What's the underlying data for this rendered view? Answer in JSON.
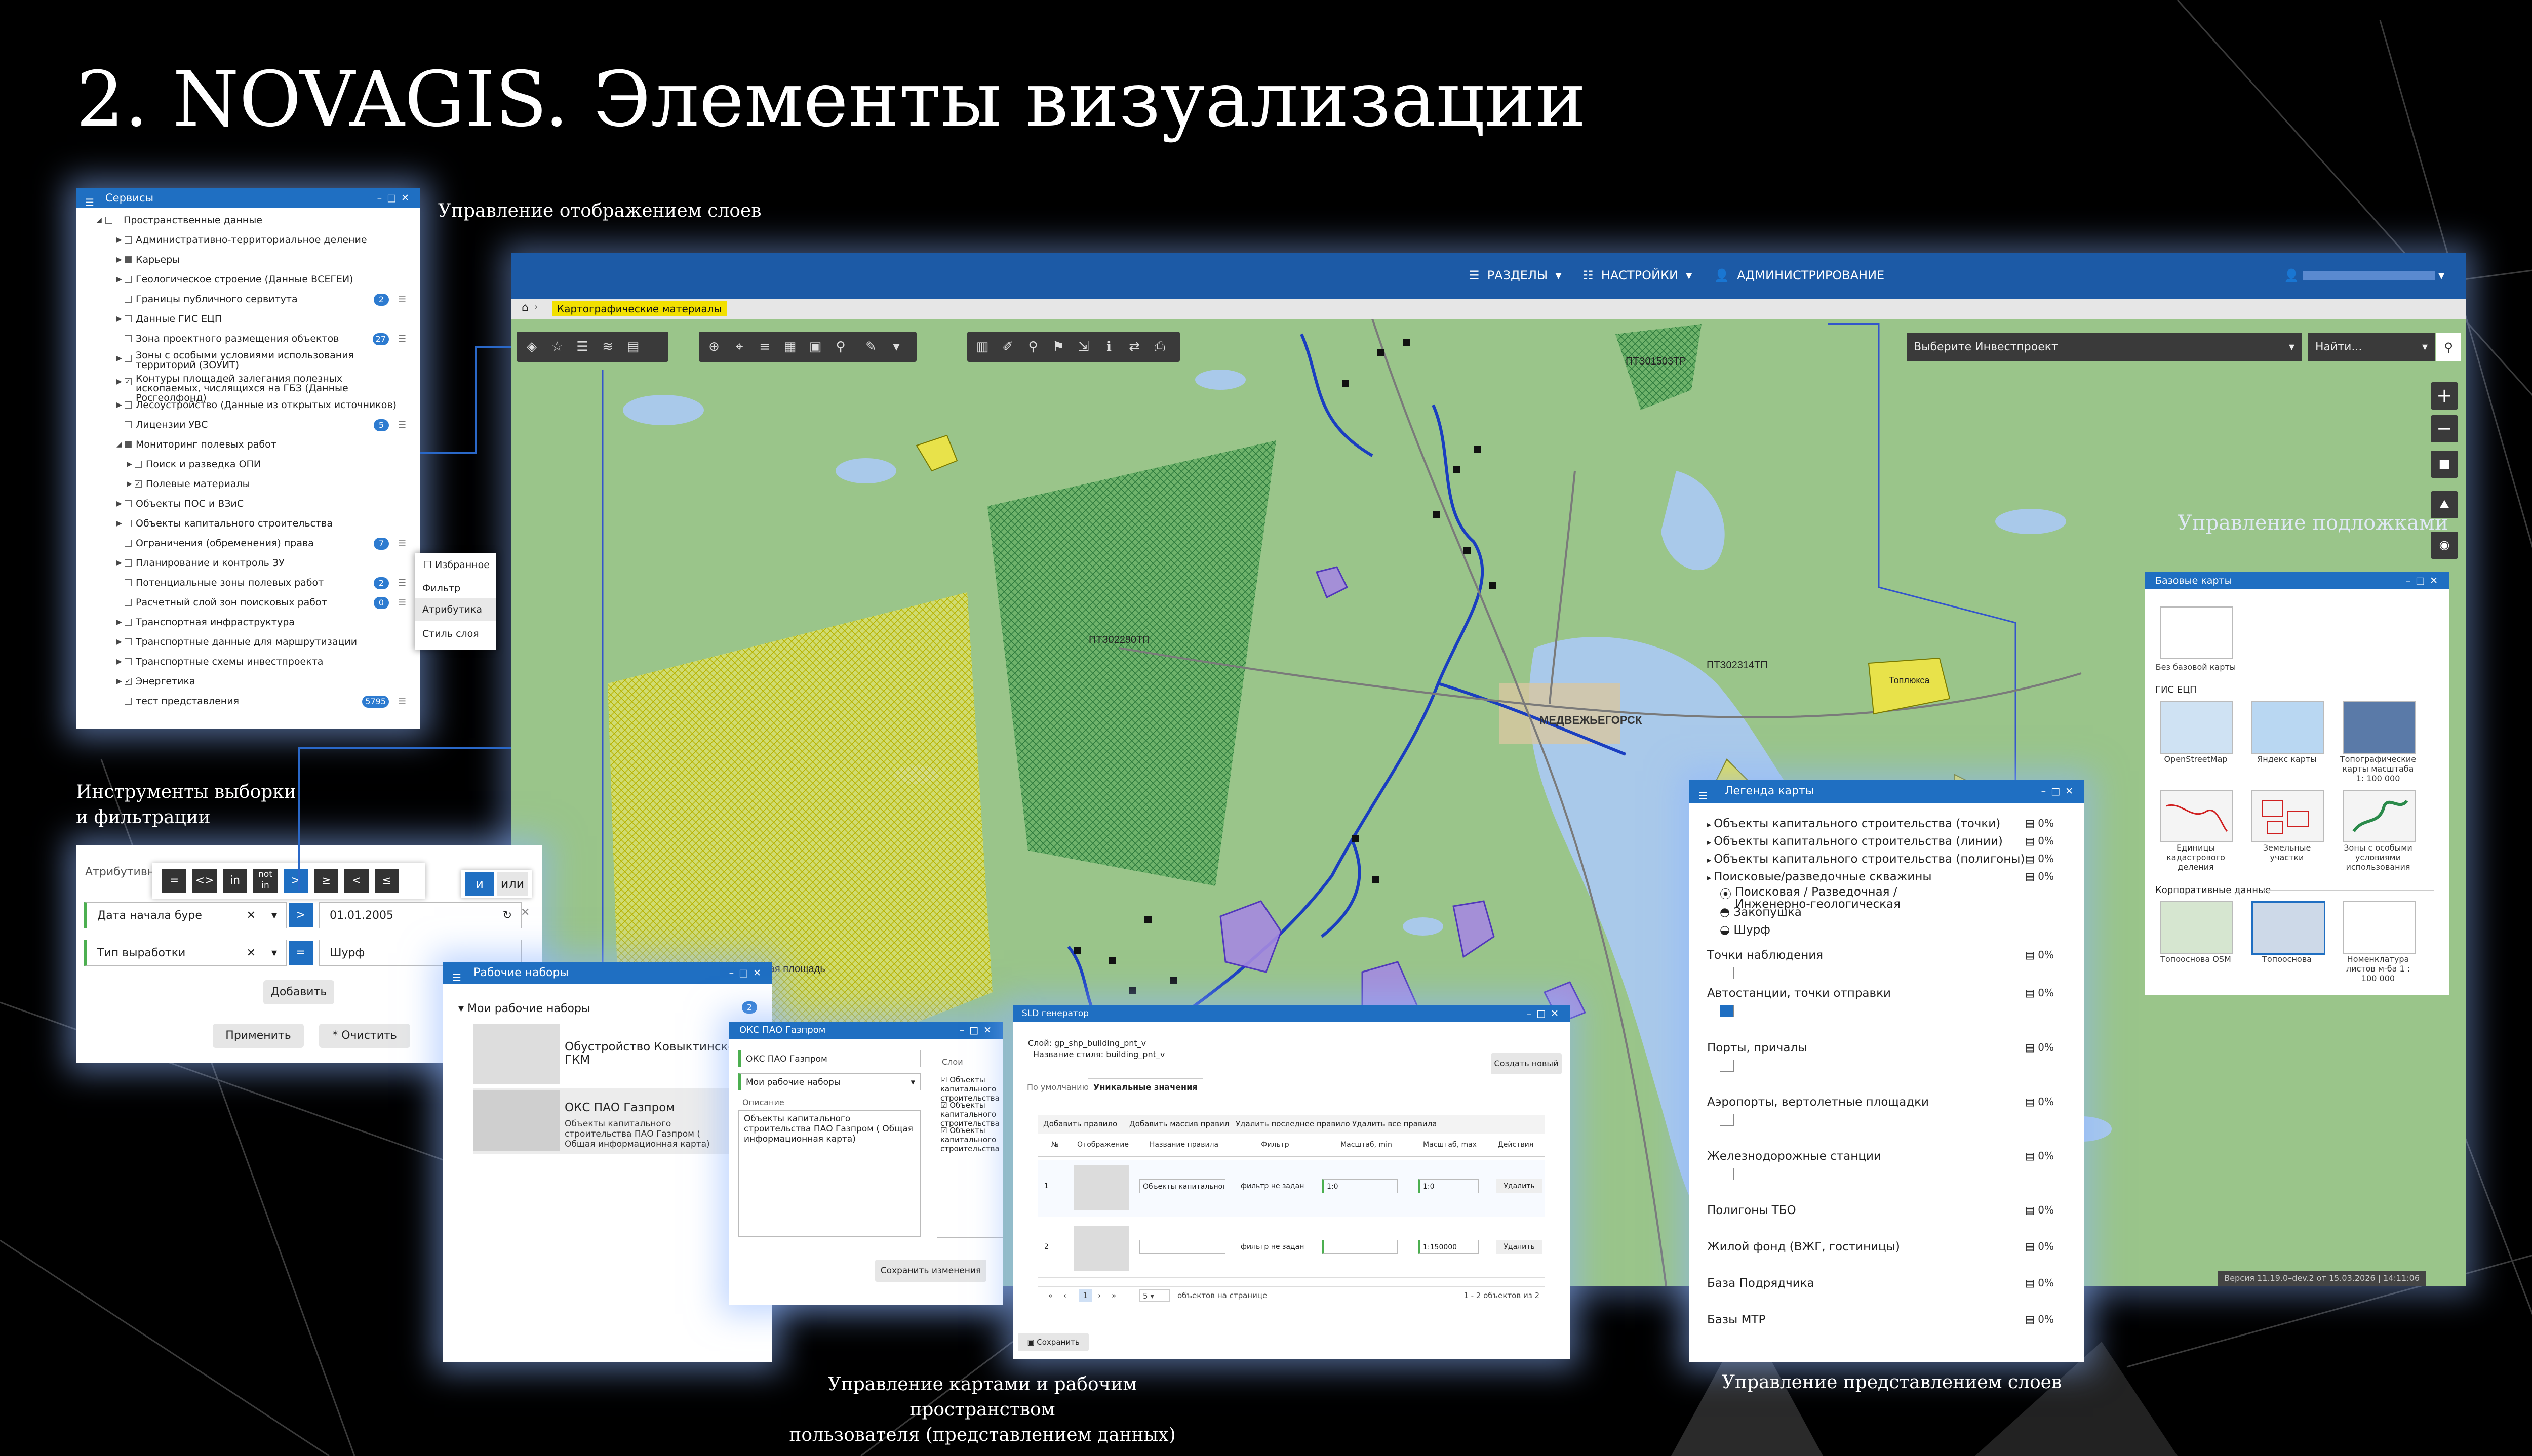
{
  "slide_title": "2. NOVAGIS. Элементы визуализации",
  "captions": {
    "layers": "Управление отображением слоев",
    "filters": "Инструменты выборки\nи фильтрации",
    "basemaps": "Управление подложками",
    "workspace": "Управление картами и рабочим пространством\nпользователя (представлением данных)",
    "legend_view": "Управление представлением слоев"
  },
  "services_window": {
    "title": "Сервисы",
    "root": "Пространственные данные",
    "items": [
      {
        "label": "Административно-территориальное деление",
        "badge": ""
      },
      {
        "label": "Карьеры",
        "badge": ""
      },
      {
        "label": "Геологическое строение (Данные ВСЕГЕИ)",
        "badge": ""
      },
      {
        "label": "Границы публичного сервитута",
        "badge": "2"
      },
      {
        "label": "Данные ГИС ЕЦП",
        "badge": ""
      },
      {
        "label": "Зона проектного размещения объектов",
        "badge": "27"
      },
      {
        "label": "Зоны с особыми условиями использования территорий (ЗОУИТ)",
        "badge": ""
      },
      {
        "label": "Контуры площадей залегания полезных ископаемых, числящихся на ГБЗ (Данные Росгеолфонд)",
        "badge": ""
      },
      {
        "label": "Лесоустройство (Данные из открытых источников)",
        "badge": ""
      },
      {
        "label": "Лицензии УВС",
        "badge": "5"
      },
      {
        "label": "Мониторинг полевых работ",
        "badge": ""
      },
      {
        "label": "Поиск и разведка ОПИ",
        "badge": ""
      },
      {
        "label": "Полевые материалы",
        "badge": ""
      },
      {
        "label": "Объекты ПОС и ВЗиС",
        "badge": ""
      },
      {
        "label": "Объекты капитального строительства",
        "badge": ""
      },
      {
        "label": "Ограничения (обременения) права",
        "badge": "7"
      },
      {
        "label": "Планирование и контроль ЗУ",
        "badge": ""
      },
      {
        "label": "Потенциальные зоны полевых работ",
        "badge": "2"
      },
      {
        "label": "Расчетный слой зон поисковых работ",
        "badge": "0"
      },
      {
        "label": "Транспортная инфраструктура",
        "badge": ""
      },
      {
        "label": "Транспортные данные для маршрутизации",
        "badge": ""
      },
      {
        "label": "Транспортные схемы инвестпроекта",
        "badge": ""
      },
      {
        "label": "Энергетика",
        "badge": ""
      },
      {
        "label": "тест представления",
        "badge": "5795"
      }
    ],
    "context_menu": [
      "Избранное",
      "Фильтр",
      "Атрибутика",
      "Стиль слоя"
    ]
  },
  "filter_window": {
    "tab": "Атрибутивн",
    "operators": [
      "=",
      "<>",
      "in",
      "not in",
      ">",
      "≥",
      "<",
      "≤"
    ],
    "logic": [
      "и",
      "или"
    ],
    "rows": [
      {
        "field": "Дата начала буре",
        "op": ">",
        "value": "01.01.2005"
      },
      {
        "field": "Тип выработки",
        "op": "=",
        "value": "Шурф"
      }
    ],
    "add_label": "Добавить",
    "apply_label": "Применить",
    "clear_label": "Очистить"
  },
  "map": {
    "nav": [
      "РАЗДЕЛЫ",
      "НАСТРОЙКИ",
      "АДМИНИСТРИРОВАНИЕ"
    ],
    "breadcrumb": "Картографические материалы",
    "investproject_placeholder": "Выберите Инвестпроект",
    "search_placeholder": "Найти...",
    "version": "Версия 11.19.0–dev.2 от 15.03.2026 | 14:11:06",
    "labels": {
      "city": "МЕДВЕЖЬЕГОРСК",
      "area1": "ПТЗ02290ТП",
      "area2": "ПТЗ01503ТР",
      "area3": "ПТЗ02314ТП",
      "area4": "Эльмусская площадь",
      "area5": "Топлюкса"
    },
    "colors": {
      "header": "#1c5aa6",
      "accent": "#1f6fc2",
      "crumb": "#f2e000"
    }
  },
  "basemaps_window": {
    "title": "Базовые карты",
    "none_label": "Без базовой карты",
    "gis_group": "ГИС ЕЦП",
    "gis_items": [
      "OpenStreetMap",
      "Яндекс карты",
      "Топографические карты масштаба 1: 100 000",
      "Единицы кадастрового деления",
      "Земельные участки",
      "Зоны с особыми условиями использования"
    ],
    "corp_group": "Корпоративные данные",
    "corp_items": [
      "Топооснова OSM",
      "Топооснова",
      "Номенклатура листов м-ба 1 : 100 000"
    ]
  },
  "legend_window": {
    "title": "Легенда карты",
    "rows": [
      {
        "label": "Объекты капитального строительства (точки)",
        "pct": "0%"
      },
      {
        "label": "Объекты капитального строительства (линии)",
        "pct": "0%"
      },
      {
        "label": "Объекты капитального строительства (полигоны)",
        "pct": "0%"
      },
      {
        "label": "Поисковые/разведочные скважины",
        "pct": "0%"
      },
      {
        "label": "Поисковая / Разведочная / Инженерно-геологическая",
        "pct": ""
      },
      {
        "label": "Закопушка",
        "pct": ""
      },
      {
        "label": "Шурф",
        "pct": ""
      },
      {
        "label": "Точки наблюдения",
        "pct": "0%"
      },
      {
        "label": "Автостанции, точки отправки",
        "pct": "0%"
      },
      {
        "label": "Порты, причалы",
        "pct": "0%"
      },
      {
        "label": "Аэропорты, вертолетные площадки",
        "pct": "0%"
      },
      {
        "label": "Железнодорожные станции",
        "pct": "0%"
      },
      {
        "label": "Полигоны ТБО",
        "pct": "0%"
      },
      {
        "label": "Жилой фонд (ВЖГ, гостиницы)",
        "pct": "0%"
      },
      {
        "label": "База Подрядчика",
        "pct": "0%"
      },
      {
        "label": "Базы МТР",
        "pct": "0%"
      }
    ]
  },
  "worksets_window": {
    "title": "Рабочие наборы",
    "group": "Мои рабочие наборы",
    "count": "2",
    "items": [
      {
        "title": "Обустройство Ковыктинского ГКМ",
        "desc": ""
      },
      {
        "title": "ОКС ПАО Газпром",
        "desc": "Объекты капитального строительства ПАО Газпром ( Общая информационная карта)"
      }
    ]
  },
  "workset_edit": {
    "title": "ОКС ПАО Газпром",
    "name_value": "ОКС ПАО Газпром",
    "set_value": "Мои рабочие наборы",
    "desc_label": "Описание",
    "desc_value": "Объекты капитального строительства ПАО Газпром ( Общая информационная карта)",
    "layers_label": "Слои",
    "layers": [
      "Объекты капитального строительства",
      "Объекты капитального строительства",
      "Объекты капитального строительства"
    ],
    "save_label": "Сохранить изменения"
  },
  "sld_window": {
    "title": "SLD генератор",
    "layer": "Слой: gp_shp_building_pnt_v",
    "style": "Название стиля: building_pnt_v",
    "create_label": "Создать новый",
    "tabs": [
      "По умолчанию",
      "Уникальные значения"
    ],
    "actions": [
      "Добавить правило",
      "Добавить массив правил",
      "Удалить последнее правило",
      "Удалить все правила"
    ],
    "columns": [
      "№",
      "Отображение",
      "Название правила",
      "Фильтр",
      "Масштаб, min",
      "Масштаб, max",
      "Действия"
    ],
    "rows": [
      {
        "n": "1",
        "name": "Объекты капитального с",
        "filter": "фильтр не задан",
        "min": "1:0",
        "max": "1:0",
        "action": "Удалить"
      },
      {
        "n": "2",
        "name": "",
        "filter": "фильтр не задан",
        "min": "",
        "max": "1:150000",
        "action": "Удалить"
      }
    ],
    "pager": {
      "page": "1",
      "size": "5",
      "per_page": "объектов на странице",
      "range": "1 - 2 объектов из 2"
    },
    "save_label": "Сохранить"
  }
}
